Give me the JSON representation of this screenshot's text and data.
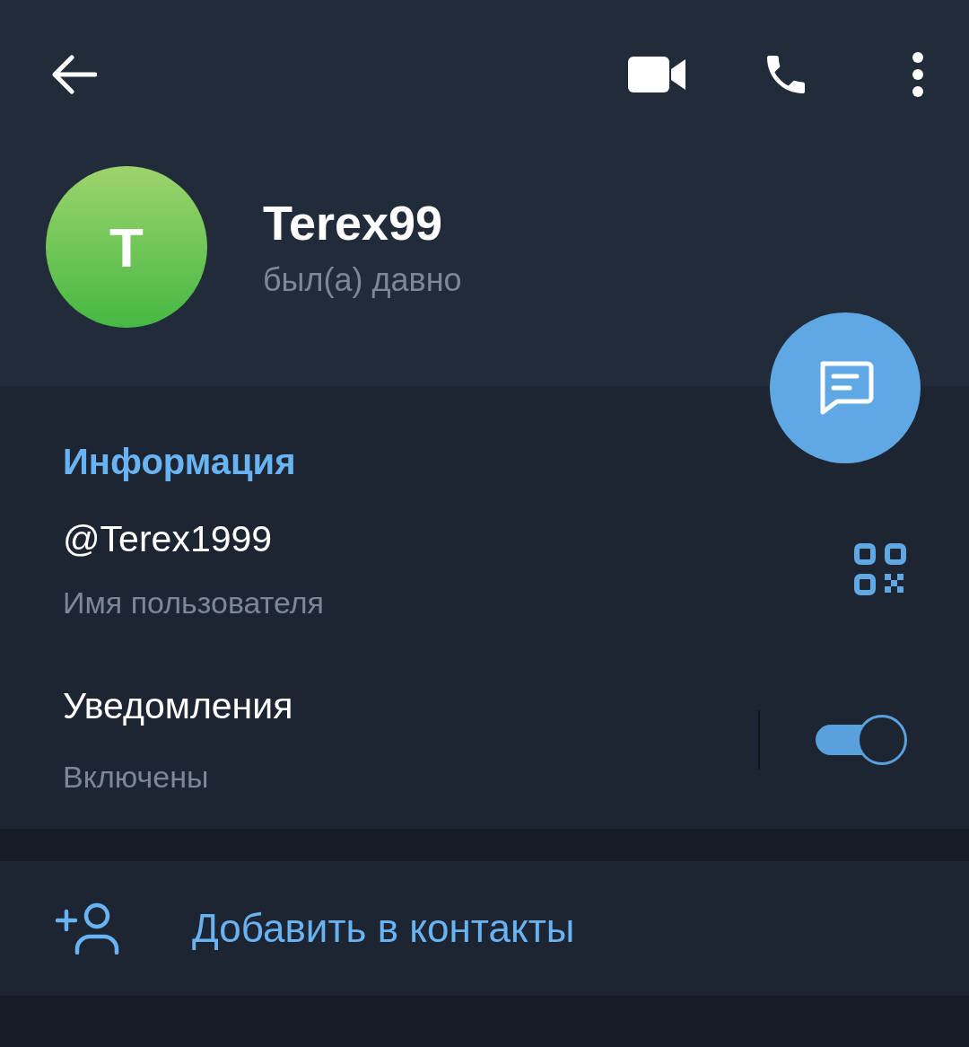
{
  "profile": {
    "avatar_letter": "T",
    "name": "Terex99",
    "status": "был(а) давно"
  },
  "info": {
    "title": "Информация",
    "username": "@Terex1999",
    "username_label": "Имя пользователя",
    "notifications": {
      "label": "Уведомления",
      "value": "Включены",
      "on": true
    }
  },
  "add_contact": {
    "label": "Добавить в контакты"
  }
}
